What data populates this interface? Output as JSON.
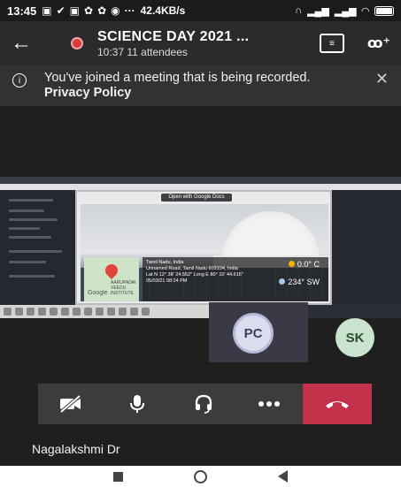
{
  "status_bar": {
    "time": "13:45",
    "net_speed": "42.4KB/s",
    "icons": [
      "message-icon",
      "check-icon",
      "message-icon",
      "pinwheel-icon",
      "pinwheel-icon",
      "whatsapp-icon",
      "headset-icon",
      "signal-icon",
      "signal-icon",
      "wifi-icon",
      "battery-icon"
    ]
  },
  "app_bar": {
    "title": "SCIENCE DAY 2021 ...",
    "subtitle": "10:37  11 attendees",
    "recording_color": "#d93b3b"
  },
  "banner": {
    "message": "You've joined a meeting that is being recorded.",
    "link": "Privacy Policy"
  },
  "shared_screen": {
    "open_button": "Open with Google Docs",
    "location_title": "Tamil Nadu, India",
    "address": "Unnamed Road, Tamil Nadu 603104, India",
    "coords": "Lat N 12° 38' 24.552\" Long E 80° 10' 44.616\"",
    "datetime": "05/03/21 08:24 PM",
    "temperature": "0.0° C",
    "wind": "234° SW",
    "map_place": "AARUPADAI VEEDU INSTITUTE",
    "map_brand": "Google"
  },
  "participants": {
    "pc": "PC",
    "sk": "SK"
  },
  "controls": {
    "end_color": "#c4314b"
  },
  "presenter_name": "Nagalakshmi Dr"
}
